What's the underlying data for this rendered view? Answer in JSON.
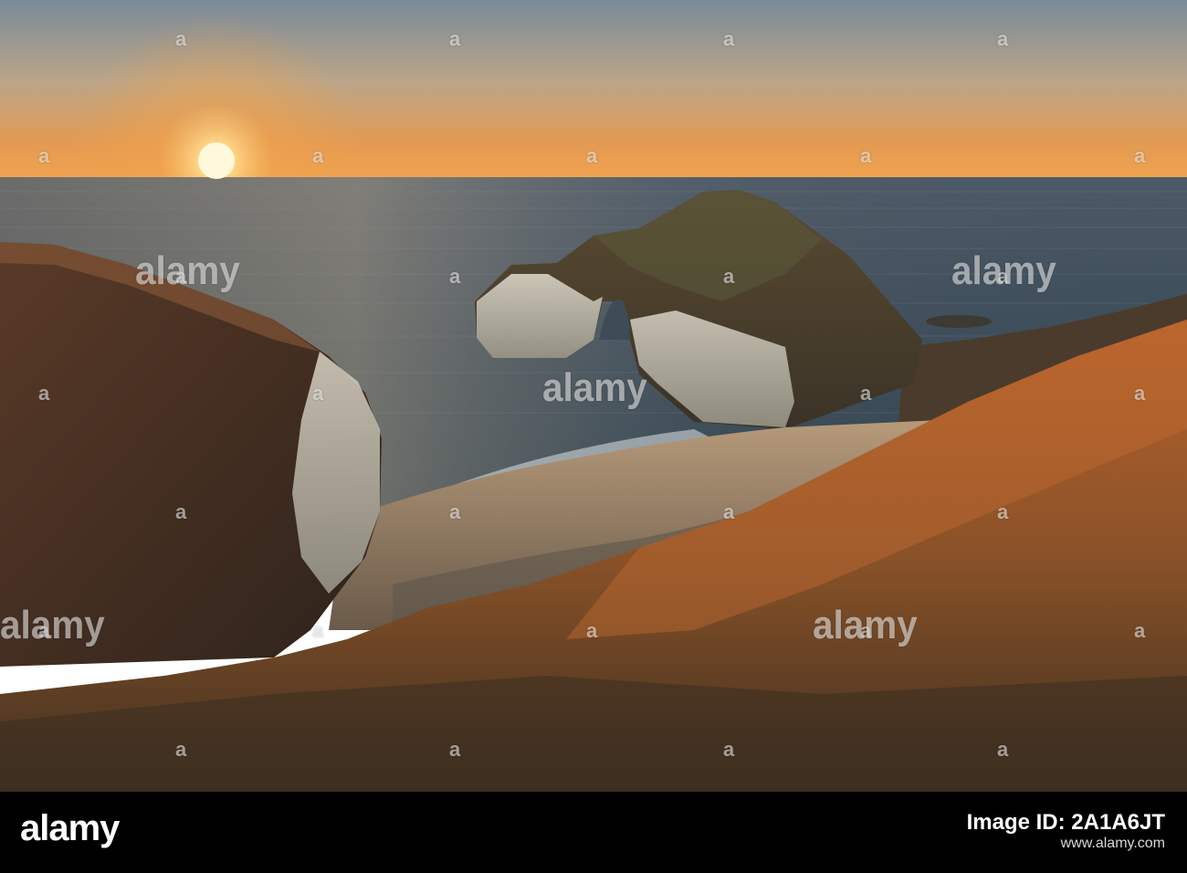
{
  "photo": {
    "description_colors": {
      "sky_top": "#7f8d9a",
      "sky_horizon": "#e79a4b",
      "sun": "#fff2c4",
      "sea": "#3b4a58",
      "cliff_dark": "#4a3426",
      "chalk": "#d8d4c8",
      "grass": "#9a5a2b"
    }
  },
  "watermarks": {
    "small_label": "a",
    "big_label": "alamy"
  },
  "footer": {
    "logo": "alamy",
    "image_id_label": "Image ID: 2A1A6JT",
    "site": "www.alamy.com"
  }
}
